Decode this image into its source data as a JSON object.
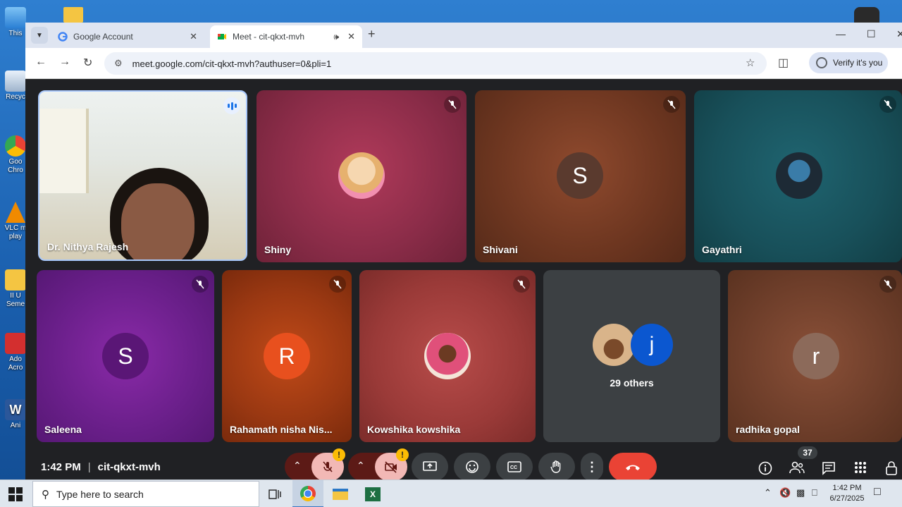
{
  "desktop": {
    "icons": [
      {
        "label": "This"
      },
      {
        "label": "Recyc"
      },
      {
        "label": "Goo Chro"
      },
      {
        "label": "VLC m play"
      },
      {
        "label": "II U Seme"
      },
      {
        "label": "Ado Acro"
      },
      {
        "label": "Ani"
      }
    ]
  },
  "browser": {
    "tabs": [
      {
        "title": "Google Account",
        "active": false
      },
      {
        "title": "Meet - cit-qkxt-mvh",
        "active": true
      }
    ],
    "url": "meet.google.com/cit-qkxt-mvh?authuser=0&pli=1",
    "verify_label": "Verify it's you"
  },
  "meet": {
    "tiles": [
      {
        "name": "Dr. Nithya Rajesh",
        "type": "video",
        "speaking": true
      },
      {
        "name": "Shiny",
        "type": "photo",
        "muted": true
      },
      {
        "name": "Shivani",
        "type": "initial",
        "initial": "S",
        "muted": true
      },
      {
        "name": "Gayathri",
        "type": "photo",
        "muted": true
      },
      {
        "name": "Saleena",
        "type": "initial",
        "initial": "S",
        "muted": true
      },
      {
        "name": "Rahamath nisha Nis...",
        "type": "initial",
        "initial": "R",
        "muted": true
      },
      {
        "name": "Kowshika kowshika",
        "type": "photo",
        "muted": true
      },
      {
        "name": "radhika gopal",
        "type": "initial",
        "initial": "r",
        "muted": true
      }
    ],
    "others": {
      "label": "29 others",
      "initial": "j"
    },
    "time": "1:42 PM",
    "meeting_code": "cit-qkxt-mvh",
    "participant_count": "37",
    "warn_glyph": "!"
  },
  "taskbar": {
    "search_placeholder": "Type here to search",
    "clock_time": "1:42 PM",
    "clock_date": "6/27/2025"
  },
  "colors": {
    "end_call": "#ea4335",
    "accent": "#1a73e8",
    "warning": "#fbbc04"
  }
}
